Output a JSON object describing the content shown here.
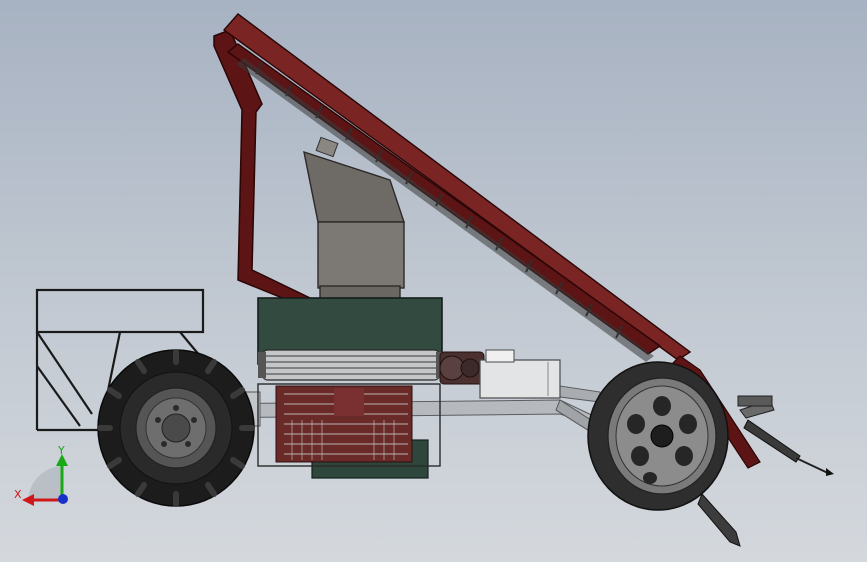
{
  "viewport": {
    "background_top": "#a7b2c2",
    "background_bottom": "#d4d8dd"
  },
  "triad": {
    "x_label": "X",
    "y_label": "Y",
    "x_color": "#d01818",
    "y_color": "#18a818",
    "z_color": "#1830c8"
  },
  "colors": {
    "frame_maroon": "#5c1414",
    "frame_maroon_light": "#7a2424",
    "body_green": "#334a40",
    "hopper_grey": "#6e6a66",
    "tire_black": "#1c1c1c",
    "rim_grey": "#8c8c8c",
    "crate_red": "#6a2a28",
    "frame_grey": "#b8bcc0",
    "tank_white": "#e2e4e6"
  },
  "icons": {
    "triad": "coordinate-triad-icon",
    "rear_wheel": "tractor-tire-icon",
    "front_wheel": "spoked-wheel-icon"
  }
}
